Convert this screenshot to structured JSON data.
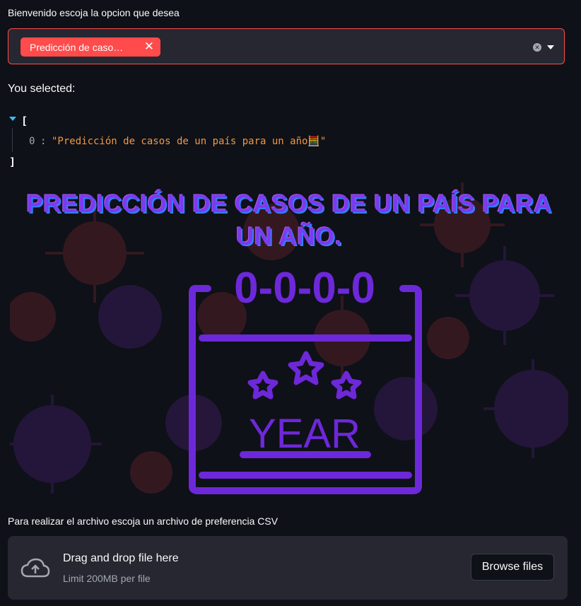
{
  "select_label": "Bienvenido escoja la opcion que desea",
  "multiselect": {
    "tag_label": "Predicción de caso…",
    "tag_close": "✕",
    "clear_icon": "clear-icon",
    "dropdown_icon": "chevron-down-icon"
  },
  "selected_heading": "You selected:",
  "json_view": {
    "open_bracket": "[",
    "close_bracket": "]",
    "index": "0",
    "colon": ":",
    "value": "\"Predicción de casos de un país para un año🧮\""
  },
  "hero": {
    "title_line1": "PREDICCIÓN DE CASOS DE UN PAÍS PARA",
    "title_line2": "UN AÑO.",
    "calendar_digits": "0-0-0-0",
    "calendar_word": "YEAR",
    "accent": "#6d28d9"
  },
  "uploader": {
    "label": "Para realizar el archivo escoja un archivo de preferencia CSV",
    "drop_text": "Drag and drop file here",
    "limit_text": "Limit 200MB per file",
    "browse_label": "Browse files"
  }
}
